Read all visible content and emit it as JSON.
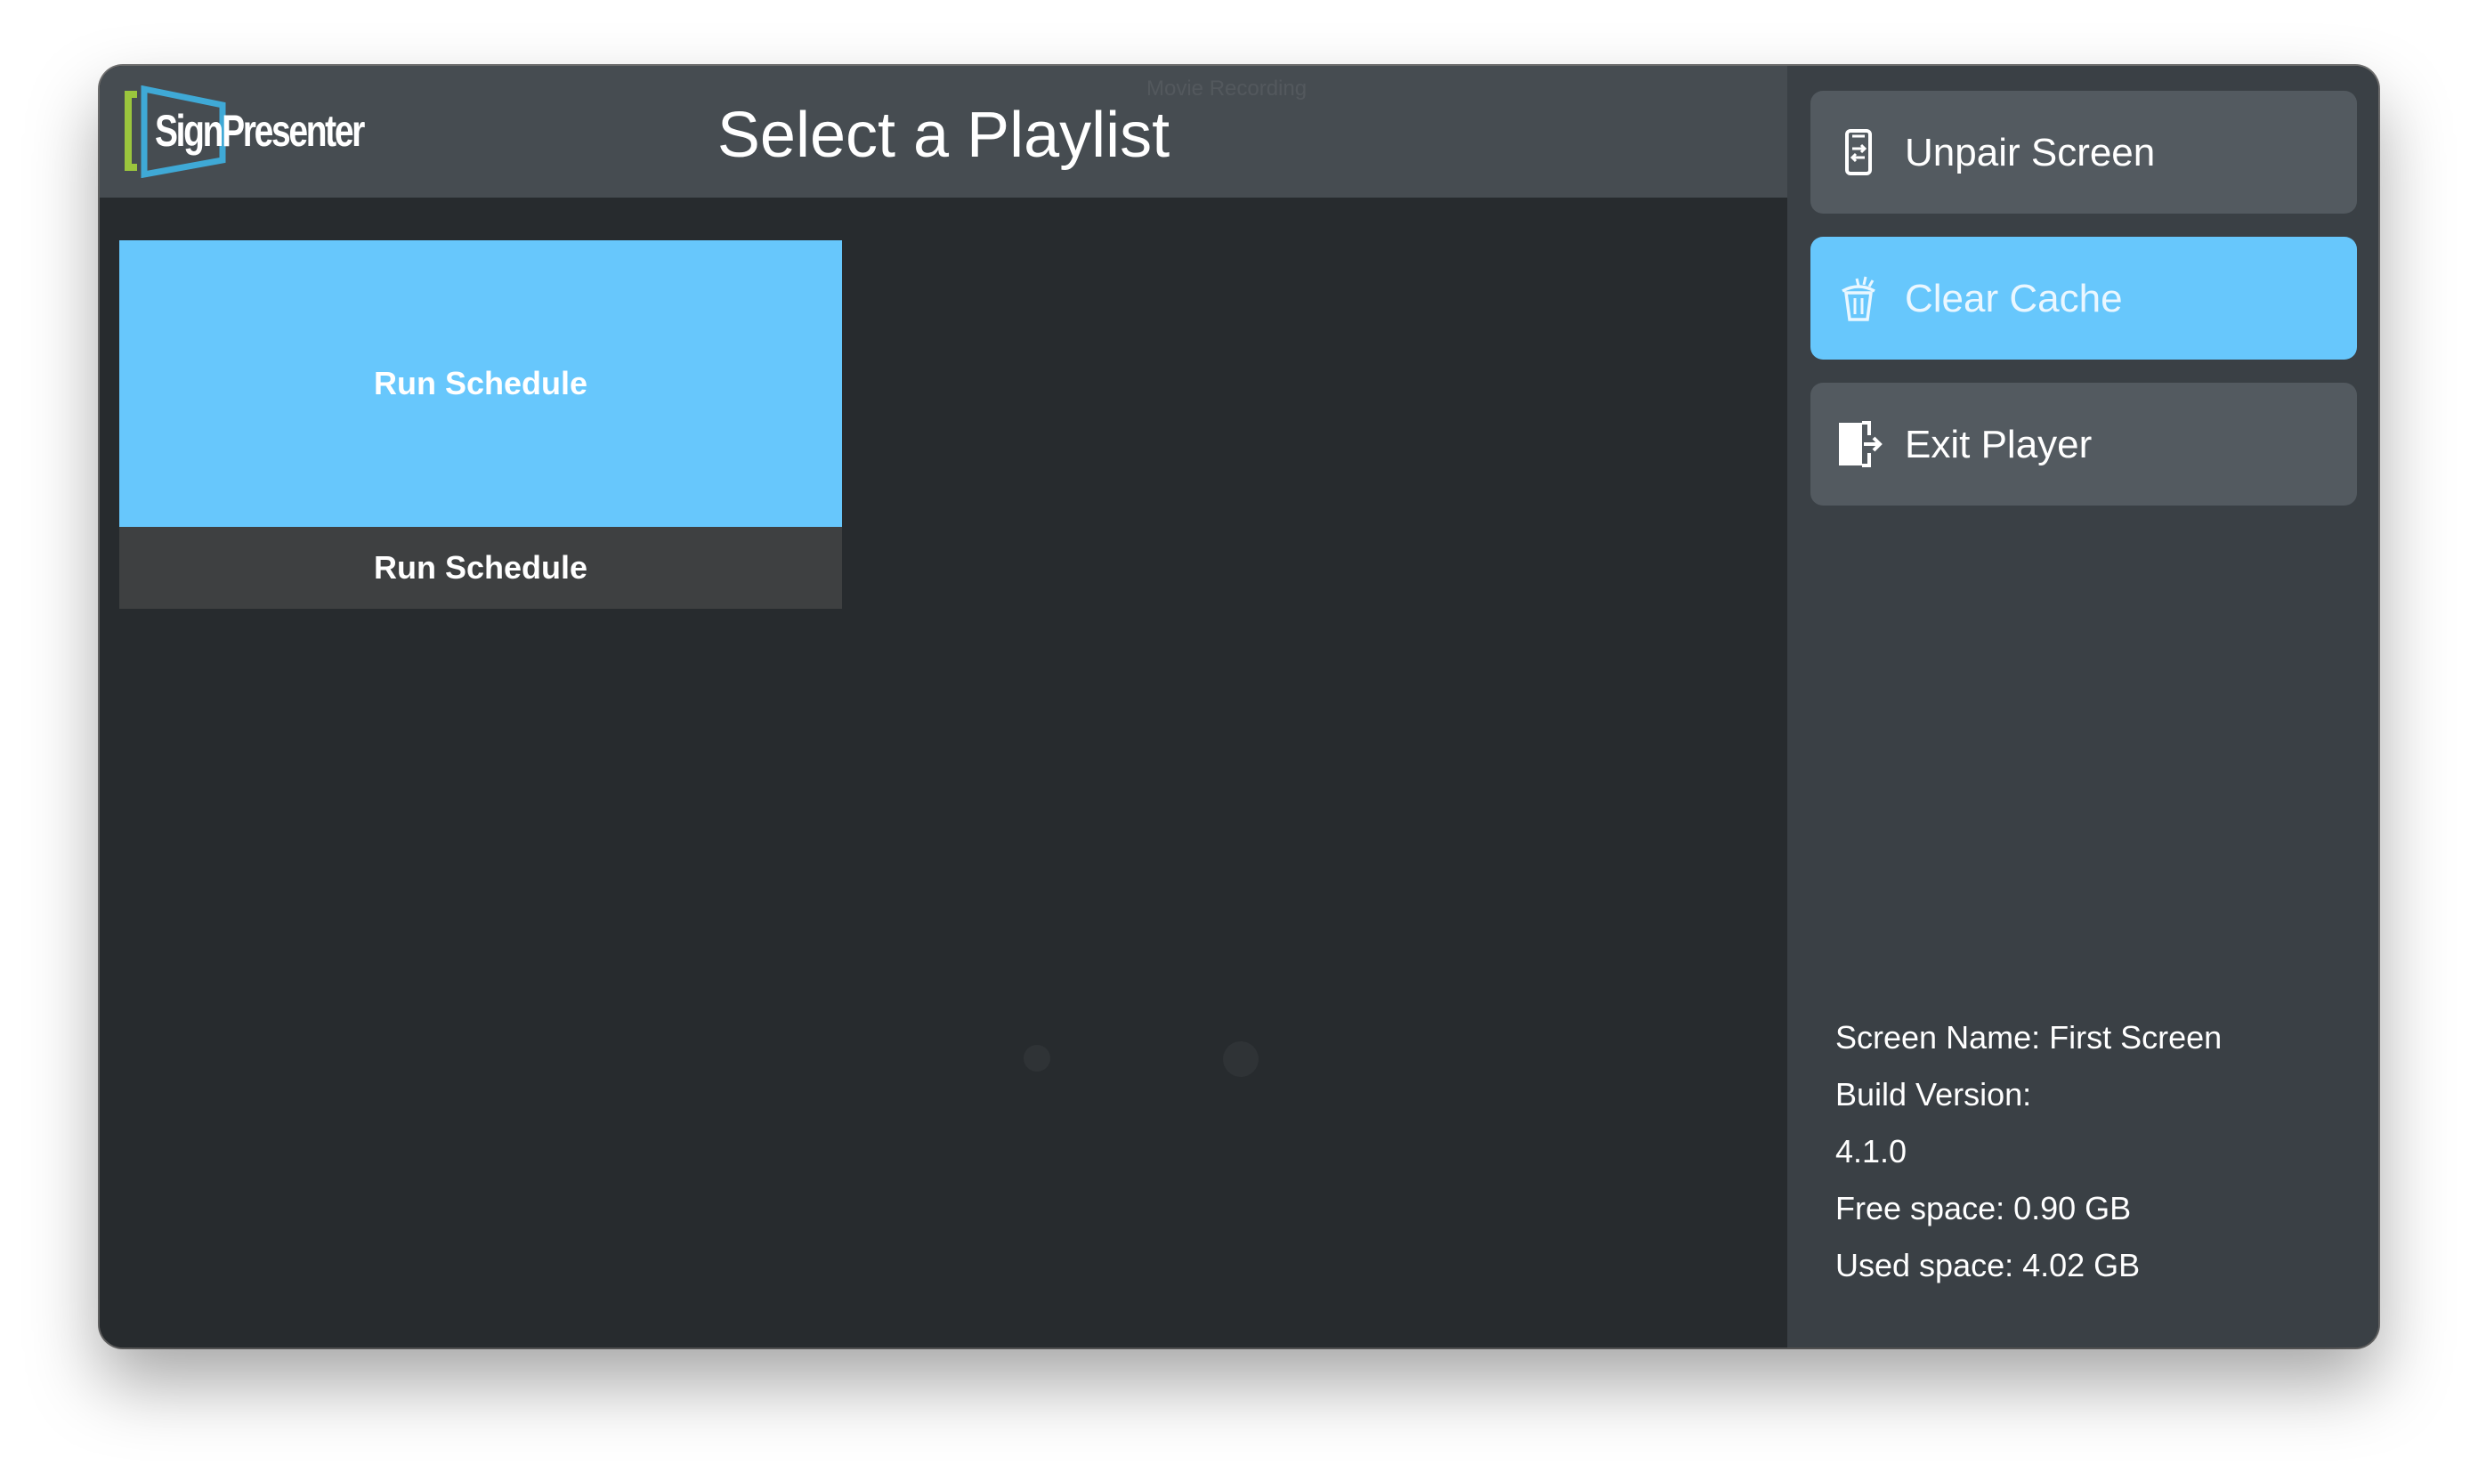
{
  "window": {
    "overlay_label": "Movie Recording"
  },
  "header": {
    "logo_text": "SignPresenter",
    "title": "Select a Playlist"
  },
  "playlists": [
    {
      "thumb_label": "Run Schedule",
      "caption": "Run Schedule"
    }
  ],
  "sidebar": {
    "buttons": [
      {
        "label": "Unpair Screen",
        "icon": "phone-unpair-icon",
        "active": false
      },
      {
        "label": "Clear Cache",
        "icon": "trash-icon",
        "active": true
      },
      {
        "label": "Exit Player",
        "icon": "exit-door-icon",
        "active": false
      }
    ],
    "info": {
      "screen_name": "Screen Name: First Screen",
      "build_version_label": "Build Version:",
      "build_version": "4.1.0",
      "free_space": "Free space: 0.90 GB",
      "used_space": "Used space: 4.02 GB"
    }
  },
  "colors": {
    "accent": "#67c7fc",
    "header_bg": "#464c51",
    "main_bg": "#272b2e",
    "sidebar_bg": "#3a4045",
    "button_bg": "#535a60",
    "logo_green": "#9bc53d",
    "logo_blue": "#3fa9d6"
  }
}
